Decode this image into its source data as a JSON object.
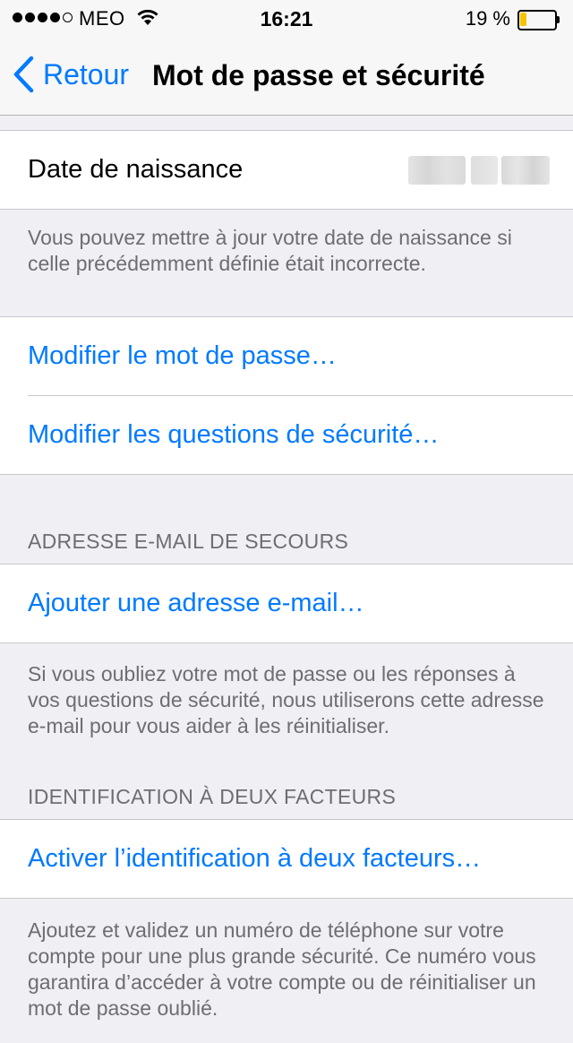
{
  "status_bar": {
    "carrier": "MEO",
    "time": "16:21",
    "battery_percent": "19 %",
    "battery_level": 0.19,
    "signal_bars_filled": 4,
    "signal_bars_total": 5
  },
  "nav": {
    "back_label": "Retour",
    "title": "Mot de passe et sécurité"
  },
  "birth_date": {
    "label": "Date de naissance",
    "footer": "Vous pouvez mettre à jour votre date de naissance si celle précédemment définie était incorrecte."
  },
  "password_actions": {
    "change_password": "Modifier le mot de passe…",
    "change_questions": "Modifier les questions de sécurité…"
  },
  "rescue_email": {
    "header": "ADRESSE E-MAIL DE SECOURS",
    "add_email": "Ajouter une adresse e-mail…",
    "footer": "Si vous oubliez votre mot de passe ou les réponses à vos questions de sécurité, nous utiliserons cette adresse e-mail pour vous aider à les réinitialiser."
  },
  "two_factor": {
    "header": "IDENTIFICATION À DEUX FACTEURS",
    "enable": "Activer l’identification à deux facteurs…",
    "footer": "Ajoutez et validez un numéro de téléphone sur votre compte pour une plus grande sécurité. Ce numéro vous garantira d’accéder à votre compte ou de réinitialiser un mot de passe oublié."
  },
  "colors": {
    "accent": "#007aff",
    "background": "#efeff4",
    "secondary_text": "#6d6d72",
    "battery_fill": "#f5c400"
  }
}
